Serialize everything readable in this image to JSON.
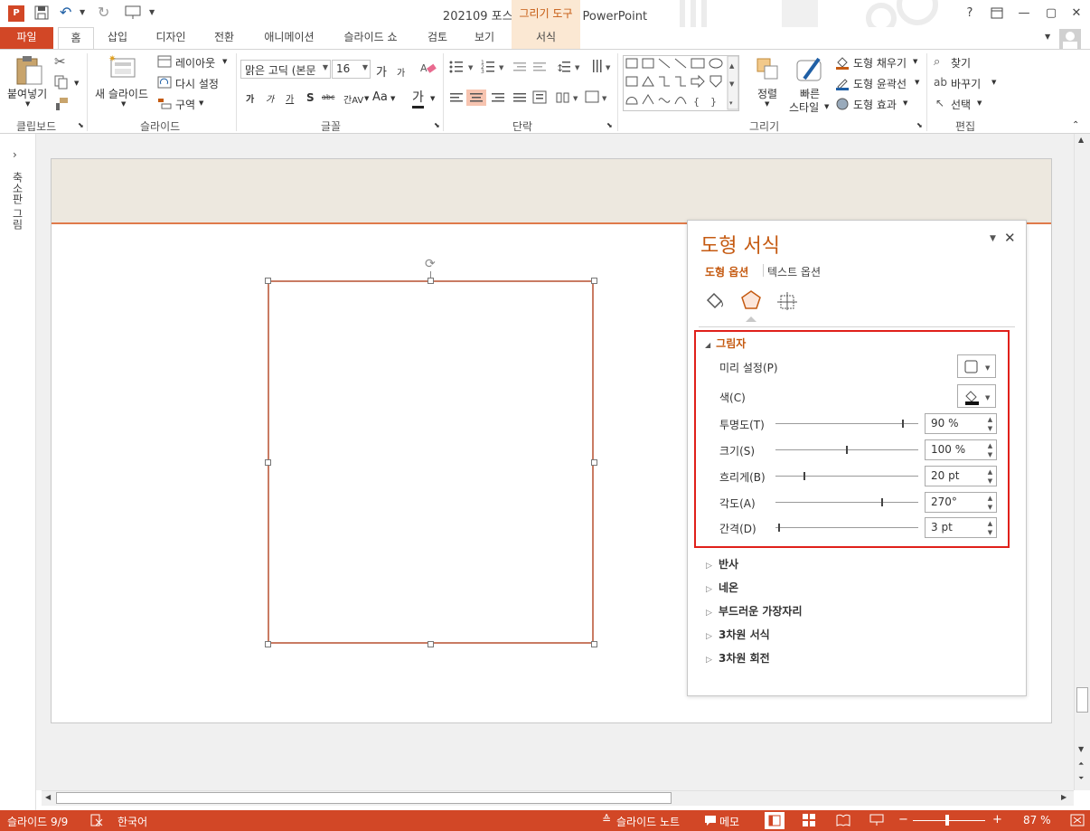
{
  "app": {
    "window_title": "202109 포스팅용 완성본 - PowerPoint",
    "context_tab_group": "그리기 도구",
    "help": "?"
  },
  "tabs": [
    {
      "label": "파일"
    },
    {
      "label": "홈"
    },
    {
      "label": "삽입"
    },
    {
      "label": "디자인"
    },
    {
      "label": "전환"
    },
    {
      "label": "애니메이션"
    },
    {
      "label": "슬라이드 쇼"
    },
    {
      "label": "검토"
    },
    {
      "label": "보기"
    },
    {
      "label": "서식"
    }
  ],
  "ribbon": {
    "clipboard": {
      "paste": "붙여넣기",
      "group": "클립보드"
    },
    "slides": {
      "new_slide": "새 슬라이드",
      "layout": "레이아웃",
      "reset": "다시 설정",
      "section": "구역",
      "group": "슬라이드"
    },
    "font": {
      "font_name": "맑은 고딕 (본문",
      "font_size": "16",
      "group": "글꼴",
      "bold": "가",
      "italic": "가",
      "underline": "가",
      "shadow": "S",
      "strike": "abc",
      "spacing": "간AV",
      "case": "Aa",
      "color": "가",
      "grow": "가",
      "shrink": "가"
    },
    "paragraph": {
      "group": "단락"
    },
    "drawing": {
      "arrange": "정렬",
      "quick_styles_1": "빠른",
      "quick_styles_2": "스타일",
      "fill": "도형 채우기",
      "outline": "도형 윤곽선",
      "effects": "도형 효과",
      "group": "그리기"
    },
    "editing": {
      "find": "찾기",
      "replace": "바꾸기",
      "select": "선택",
      "group": "편집"
    }
  },
  "thumbnail_pane": {
    "label": "축소판 그림"
  },
  "format_pane": {
    "title": "도형 서식",
    "tabs": [
      "도형 옵션",
      "텍스트 옵션"
    ],
    "shadow_section": "그림자",
    "preset_label": "미리 설정(P)",
    "color_label": "색(C)",
    "properties": [
      {
        "label": "투명도(T)",
        "value": "90 %",
        "fraction": 0.9
      },
      {
        "label": "크기(S)",
        "value": "100 %",
        "fraction": 0.5
      },
      {
        "label": "흐리게(B)",
        "value": "20 pt",
        "fraction": 0.2
      },
      {
        "label": "각도(A)",
        "value": "270°",
        "fraction": 0.75
      },
      {
        "label": "간격(D)",
        "value": "3 pt",
        "fraction": 0.02
      }
    ],
    "collapsed_sections": [
      "반사",
      "네온",
      "부드러운 가장자리",
      "3차원 서식",
      "3차원 회전"
    ]
  },
  "status": {
    "slide": "슬라이드 9/9",
    "language": "한국어",
    "notes": "슬라이드 노트",
    "comments": "메모",
    "zoom": "87 %"
  },
  "colors": {
    "accent": "#d24726",
    "title_orange": "#c55a11",
    "highlight_box": "#e0201a"
  }
}
